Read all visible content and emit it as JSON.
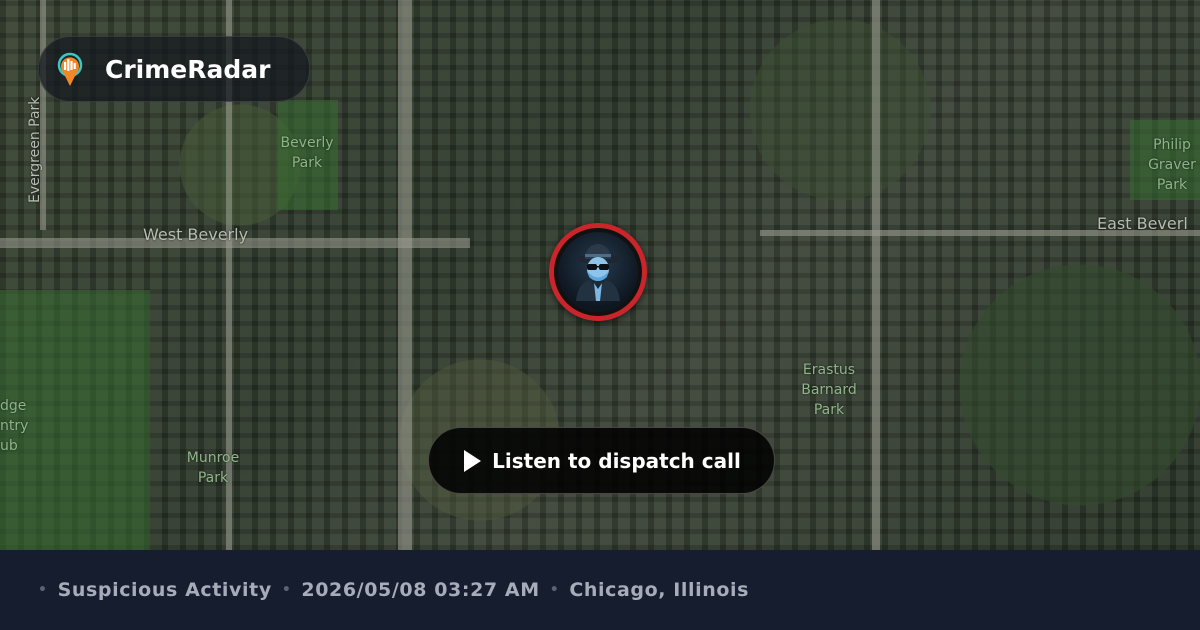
{
  "brand": {
    "name": "CrimeRadar",
    "logo_icon": "radar-pin-logo-icon"
  },
  "map": {
    "labels": {
      "evergreen": "Evergreen Park",
      "beverly_park_1": "Beverly",
      "beverly_park_2": "Park",
      "west_beverly": "West Beverly",
      "philip_1": "Philip",
      "philip_2": "Graver",
      "philip_3": "Park",
      "east_beverly": "East Beverl",
      "erastus_1": "Erastus",
      "erastus_2": "Barnard",
      "erastus_3": "Park",
      "munroe_1": "Munroe",
      "munroe_2": "Park",
      "ridge_1": "dge",
      "ridge_2": "ntry",
      "ridge_3": "ub"
    }
  },
  "marker": {
    "icon": "incognito-spy-icon",
    "accent_color": "#c9252b"
  },
  "listen_button": {
    "label": "Listen to dispatch call",
    "icon": "play-icon"
  },
  "footer": {
    "separator": "•",
    "category": "Suspicious Activity",
    "datetime": "2026/05/08 03:27 AM",
    "location": "Chicago, Illinois"
  }
}
